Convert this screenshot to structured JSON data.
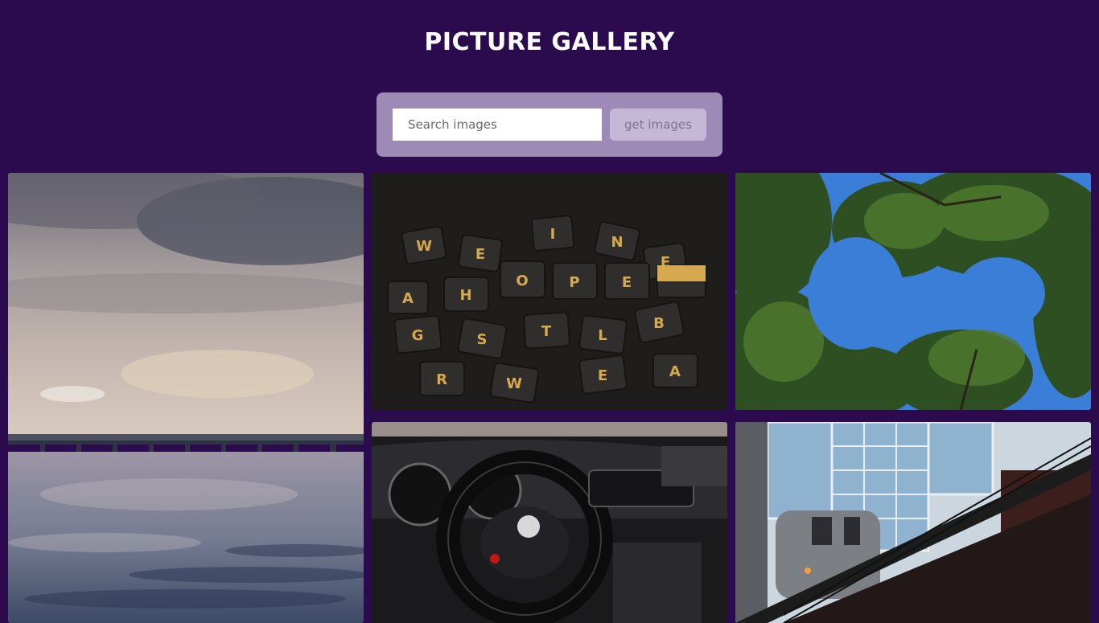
{
  "header": {
    "title": "PICTURE GALLERY"
  },
  "search": {
    "placeholder": "Search images",
    "value": "",
    "button_label": "get images"
  },
  "gallery": {
    "images": [
      {
        "subject": "cloudy sky over calm sea with pier"
      },
      {
        "subject": "scrabble tiles spelling HOPE"
      },
      {
        "subject": "tree canopy against blue sky"
      },
      {
        "subject": "car interior steering wheel"
      },
      {
        "subject": "elevated train by glass building"
      }
    ]
  },
  "colors": {
    "background": "#2b0b4e",
    "panel": "#9d8ab7",
    "button": "#c4b8d6",
    "title": "#ffffff"
  }
}
